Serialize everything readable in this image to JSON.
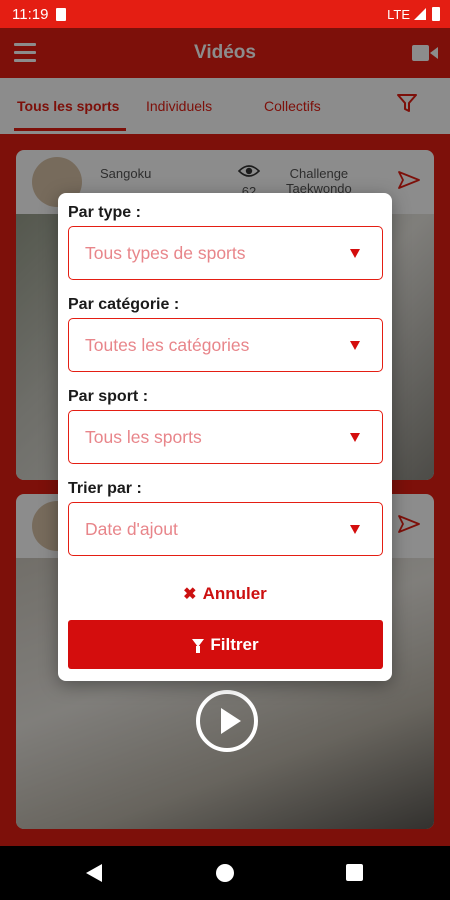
{
  "status_bar": {
    "time": "11:19",
    "network": "LTE"
  },
  "app_bar": {
    "title": "Vidéos",
    "menu_icon": "hamburger-menu-icon",
    "camera_icon": "video-camera-icon"
  },
  "tabs": [
    {
      "label": "Tous les sports",
      "active": true
    },
    {
      "label": "Individuels",
      "active": false
    },
    {
      "label": "Collectifs",
      "active": false
    }
  ],
  "feed": {
    "cards": [
      {
        "user": "Sangoku",
        "subtitle": "",
        "views": "62",
        "challenge_line1": "Challenge",
        "challenge_line2": "Taekwondo"
      }
    ]
  },
  "filter_dialog": {
    "type_label": "Par type :",
    "type_value": "Tous types de sports",
    "category_label": "Par catégorie :",
    "category_value": "Toutes les catégories",
    "sport_label": "Par sport :",
    "sport_value": "Tous les sports",
    "sort_label": "Trier par :",
    "sort_value": "Date d'ajout",
    "cancel_label": "Annuler",
    "cancel_icon": "x-icon",
    "filter_label": "Filtrer",
    "filter_icon": "funnel-icon"
  },
  "colors": {
    "accent": "#e41e13",
    "button": "#d40d0d",
    "placeholder": "#e8858a"
  }
}
